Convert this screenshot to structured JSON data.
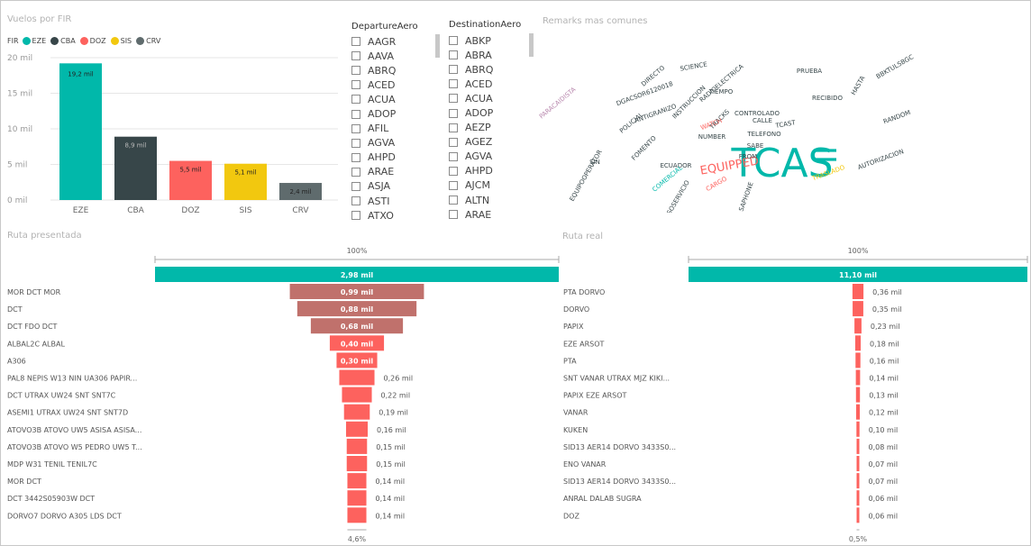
{
  "colors": {
    "teal": "#01b8aa",
    "dark": "#374649",
    "red": "#fd625e",
    "yellow": "#f2c80f",
    "gray": "#5f6b6d",
    "funnel": "#fd625e",
    "funnel_top": "#01b8aa",
    "funnel_dim": "#c0716c"
  },
  "fir_chart": {
    "title": "Vuelos por FIR",
    "legend_label": "FIR",
    "legend": [
      {
        "name": "EZE",
        "color": "#01b8aa"
      },
      {
        "name": "CBA",
        "color": "#374649"
      },
      {
        "name": "DOZ",
        "color": "#fd625e"
      },
      {
        "name": "SIS",
        "color": "#f2c80f"
      },
      {
        "name": "CRV",
        "color": "#5f6b6d"
      }
    ],
    "yticks": [
      "20 mil",
      "15 mil",
      "10 mil",
      "5 mil",
      "0 mil"
    ]
  },
  "chart_data": [
    {
      "type": "bar",
      "title": "Vuelos por FIR",
      "categories": [
        "EZE",
        "CBA",
        "DOZ",
        "SIS",
        "CRV"
      ],
      "values": [
        19.2,
        8.9,
        5.5,
        5.1,
        2.4
      ],
      "data_labels": [
        "19,2 mil",
        "8,9 mil",
        "5,5 mil",
        "5,1 mil",
        "2,4 mil"
      ],
      "colors": [
        "#01b8aa",
        "#374649",
        "#fd625e",
        "#f2c80f",
        "#5f6b6d"
      ],
      "ylim": [
        0,
        20
      ],
      "yticks": [
        0,
        5,
        10,
        15,
        20
      ],
      "grid": true,
      "legend_title": "FIR",
      "legend_position": "top-left"
    },
    {
      "type": "funnel",
      "title": "Ruta presentada",
      "top_label": "100%",
      "bottom_label": "4,6%",
      "total_label": "2,98 mil",
      "total": 2.98,
      "categories": [
        "MOR DCT MOR",
        "DCT",
        "DCT FDO DCT",
        "ALBAL2C ALBAL",
        "A306",
        "PAL8 NEPIS W13 NIN UA306 PAPIR...",
        "DCT UTRAX UW24 SNT SNT7C",
        "ASEMI1 UTRAX UW24 SNT SNT7D",
        "ATOVO3B ATOVO UW5 ASISA ASISA...",
        "ATOVO3B ATOVO W5 PEDRO UW5 T...",
        "MDP W31 TENIL TENIL7C",
        "MOR DCT",
        "DCT 3442S05903W DCT",
        "DORVO7 DORVO A305 LDS DCT"
      ],
      "values": [
        0.99,
        0.88,
        0.68,
        0.4,
        0.3,
        0.26,
        0.22,
        0.19,
        0.16,
        0.15,
        0.15,
        0.14,
        0.14,
        0.14
      ],
      "data_labels": [
        "0,99 mil",
        "0,88 mil",
        "0,68 mil",
        "0,40 mil",
        "0,30 mil",
        "0,26 mil",
        "0,22 mil",
        "0,19 mil",
        "0,16 mil",
        "0,15 mil",
        "0,15 mil",
        "0,14 mil",
        "0,14 mil",
        "0,14 mil"
      ]
    },
    {
      "type": "funnel",
      "title": "Ruta real",
      "top_label": "100%",
      "bottom_label": "0,5%",
      "total_label": "11,10 mil",
      "total": 11.1,
      "categories": [
        "PTA DORVO",
        "DORVO",
        "PAPIX",
        "EZE ARSOT",
        "PTA",
        "SNT VANAR UTRAX MJZ KIKI...",
        "PAPIX EZE ARSOT",
        "VANAR",
        "KUKEN",
        "SID13 AER14 DORVO 3433S0...",
        "ENO VANAR",
        "SID13 AER14 DORVO 3433S0...",
        "ANRAL DALAB SUGRA",
        "DOZ"
      ],
      "values": [
        0.36,
        0.35,
        0.23,
        0.18,
        0.16,
        0.14,
        0.13,
        0.12,
        0.1,
        0.08,
        0.07,
        0.07,
        0.06,
        0.06
      ],
      "data_labels": [
        "0,36 mil",
        "0,35 mil",
        "0,23 mil",
        "0,18 mil",
        "0,16 mil",
        "0,14 mil",
        "0,13 mil",
        "0,12 mil",
        "0,10 mil",
        "0,08 mil",
        "0,07 mil",
        "0,07 mil",
        "0,06 mil",
        "0,06 mil"
      ]
    }
  ],
  "departure_slicer": {
    "title": "DepartureAero",
    "items": [
      "AAGR",
      "AAVA",
      "ABRQ",
      "ACED",
      "ACUA",
      "ADOP",
      "AFIL",
      "AGVA",
      "AHPD",
      "ARAE",
      "ASJA",
      "ASTI",
      "ATXO"
    ]
  },
  "destination_slicer": {
    "title": "DestinationAero",
    "items": [
      "ABKP",
      "ABRA",
      "ABRQ",
      "ACED",
      "ACUA",
      "ADOP",
      "AEZP",
      "AGEZ",
      "AGVA",
      "AHPD",
      "AJCM",
      "ALTN",
      "ARAE"
    ]
  },
  "wordcloud": {
    "title": "Remarks mas comunes",
    "words": [
      {
        "text": "TCAS",
        "color": "#01b8aa",
        "weight": 5
      },
      {
        "text": "II",
        "color": "#01b8aa",
        "weight": 4
      },
      {
        "text": "EQUIPPED",
        "color": "#fd625e",
        "weight": 2
      },
      {
        "text": "AUTORIZACION",
        "color": "#374649",
        "weight": 1
      },
      {
        "text": "RANDOM",
        "color": "#374649",
        "weight": 1
      },
      {
        "text": "TELEFONO",
        "color": "#374649",
        "weight": 1
      },
      {
        "text": "ECUADOR",
        "color": "#374649",
        "weight": 1
      },
      {
        "text": "SAPHONE",
        "color": "#374649",
        "weight": 1
      },
      {
        "text": "FROM",
        "color": "#374649",
        "weight": 1
      },
      {
        "text": "SCIENCE",
        "color": "#374649",
        "weight": 1
      },
      {
        "text": "PRUEBA",
        "color": "#374649",
        "weight": 1
      },
      {
        "text": "RECIBIDO",
        "color": "#374649",
        "weight": 1
      },
      {
        "text": "INSTRUCCION",
        "color": "#374649",
        "weight": 1
      },
      {
        "text": "POLICIAL",
        "color": "#374649",
        "weight": 1
      },
      {
        "text": "NUMBER",
        "color": "#374649",
        "weight": 1
      },
      {
        "text": "TIEMPO",
        "color": "#374649",
        "weight": 1
      },
      {
        "text": "SABE",
        "color": "#374649",
        "weight": 1
      },
      {
        "text": "TRACKS",
        "color": "#374649",
        "weight": 1
      },
      {
        "text": "FOMENTO",
        "color": "#374649",
        "weight": 1
      },
      {
        "text": "CONTROLADO",
        "color": "#374649",
        "weight": 1
      },
      {
        "text": "HASTA",
        "color": "#374649",
        "weight": 1
      },
      {
        "text": "CALLE",
        "color": "#374649",
        "weight": 1
      },
      {
        "text": "TRASLADO",
        "color": "#f2c80f",
        "weight": 1
      },
      {
        "text": "COMERCIAL",
        "color": "#01b8aa",
        "weight": 1
      },
      {
        "text": "CARGO",
        "color": "#fd625e",
        "weight": 1
      },
      {
        "text": "WATCH",
        "color": "#fd625e",
        "weight": 1
      },
      {
        "text": "PARACAIDISTA",
        "color": "#b887ad",
        "weight": 1
      },
      {
        "text": "ATRASOSERVICIO",
        "color": "#374649",
        "weight": 1
      },
      {
        "text": "DGACSOR6120018",
        "color": "#374649",
        "weight": 1
      },
      {
        "text": "BBKTULSBGC",
        "color": "#374649",
        "weight": 1
      },
      {
        "text": "EQUIPOOPERATOR",
        "color": "#374649",
        "weight": 1
      },
      {
        "text": "SIN",
        "color": "#374649",
        "weight": 1
      },
      {
        "text": "DIRECTO",
        "color": "#374649",
        "weight": 1
      },
      {
        "text": "RADIOELECTRICA",
        "color": "#374649",
        "weight": 1
      },
      {
        "text": "TCAST",
        "color": "#374649",
        "weight": 1
      },
      {
        "text": "ANTIGRANIZO",
        "color": "#374649",
        "weight": 1
      }
    ]
  }
}
